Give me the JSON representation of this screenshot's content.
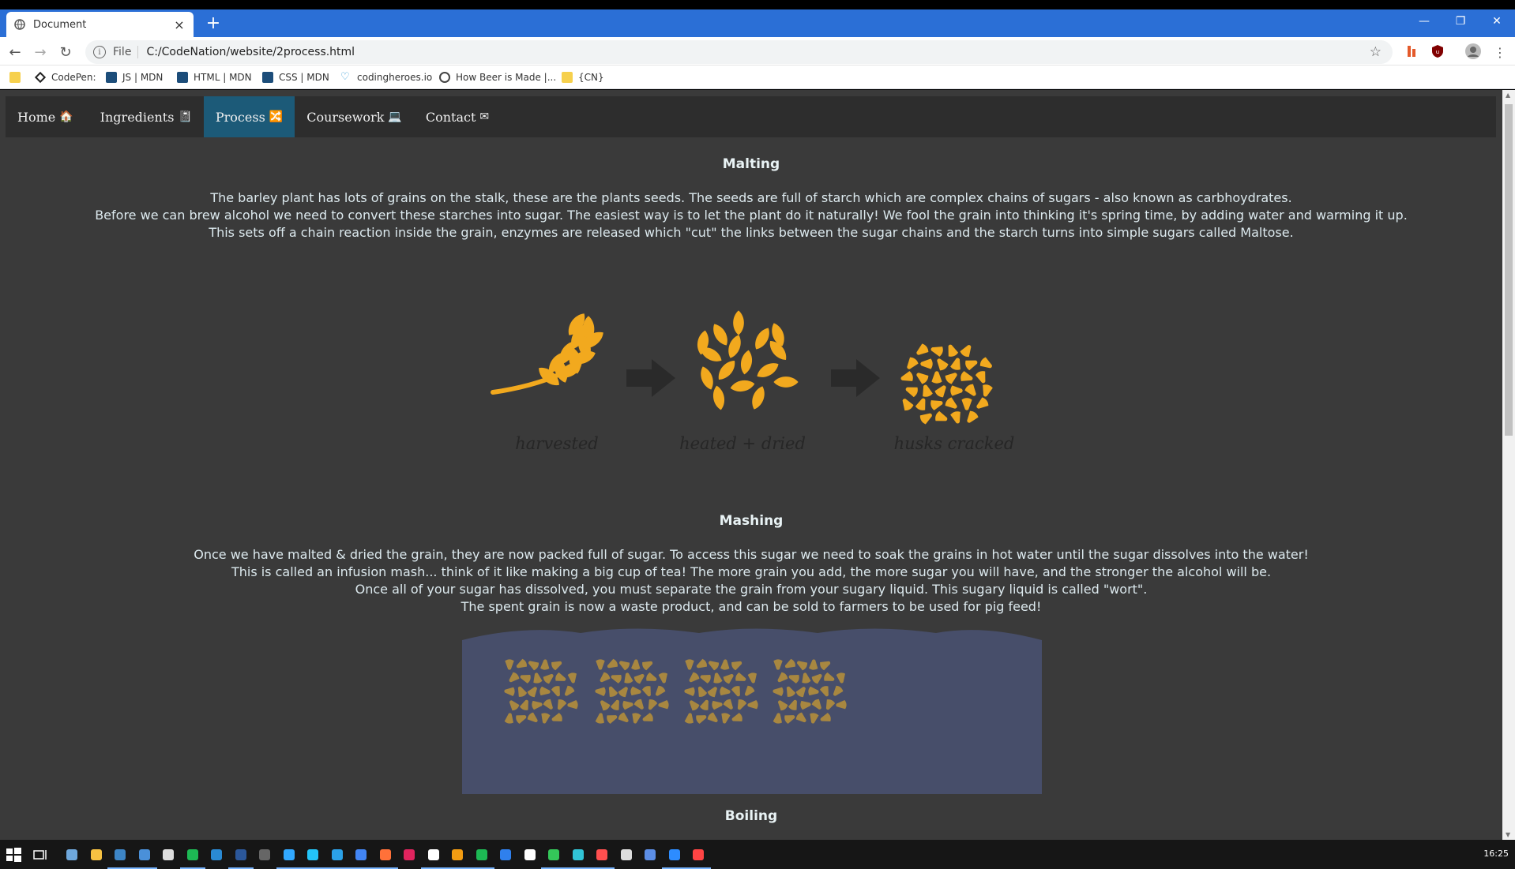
{
  "browser": {
    "tab_title": "Document",
    "address_scheme": "File",
    "address_url": "C:/CodeNation/website/2process.html",
    "bookmarks": [
      {
        "label": "",
        "icon": "folder-icon"
      },
      {
        "label": "CodePen:",
        "icon": "codepen-icon"
      },
      {
        "label": "JS | MDN",
        "icon": "mdn-icon"
      },
      {
        "label": "HTML | MDN",
        "icon": "mdn-icon"
      },
      {
        "label": "CSS | MDN",
        "icon": "mdn-icon"
      },
      {
        "label": "codingheroes.io",
        "icon": "heart-icon"
      },
      {
        "label": "How Beer is Made |...",
        "icon": "globe-icon"
      },
      {
        "label": "{CN}",
        "icon": "folder-icon"
      }
    ]
  },
  "nav": {
    "items": [
      {
        "label": "Home",
        "emoji": "🏠",
        "active": false
      },
      {
        "label": "Ingredients",
        "emoji": "📓",
        "active": false
      },
      {
        "label": "Process",
        "emoji": "🔀",
        "active": true
      },
      {
        "label": "Coursework",
        "emoji": "💻",
        "active": false
      },
      {
        "label": "Contact",
        "emoji": "✉",
        "active": false
      }
    ]
  },
  "malting": {
    "heading": "Malting",
    "lines": [
      "The barley plant has lots of grains on the stalk, these are the plants seeds. The seeds are full of starch which are complex chains of sugars - also known as carbhoydrates.",
      "Before we can brew alcohol we need to convert these starches into sugar. The easiest way is to let the plant do it naturally! We fool the grain into thinking it's spring time, by adding water and warming it up.",
      "This sets off a chain reaction inside the grain, enzymes are released which \"cut\" the links between the sugar chains and the starch turns into simple sugars called Maltose."
    ],
    "captions": [
      "harvested",
      "heated + dried",
      "husks cracked"
    ]
  },
  "mashing": {
    "heading": "Mashing",
    "lines": [
      "Once we have malted & dried the grain, they are now packed full of sugar. To access this sugar we need to soak the grains in hot water until the sugar dissolves into the water!",
      "This is called an infusion mash... think of it like making a big cup of tea! The more grain you add, the more sugar you will have, and the stronger the alcohol will be.",
      "Once all of your sugar has dissolved, you must separate the grain from your sugary liquid. This sugary liquid is called \"wort\".",
      "The spent grain is now a waste product, and can be sold to farmers to be used for pig feed!"
    ]
  },
  "boiling": {
    "heading": "Boiling"
  },
  "colors": {
    "grain": "#f2a91e",
    "grain_muted": "#a88740",
    "water": "#474e6a",
    "page_bg": "#3a3a3a",
    "nav_active": "#1c5a78"
  },
  "taskbar": {
    "time": "16:25"
  }
}
